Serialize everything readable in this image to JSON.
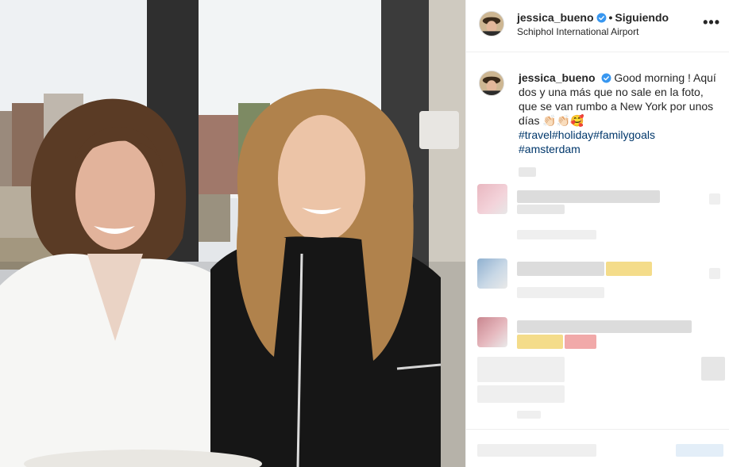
{
  "post": {
    "username": "jessica_bueno",
    "follow_status": "Siguiendo",
    "location": "Schiphol International Airport",
    "more_label": "•••"
  },
  "caption": {
    "username": "jessica_bueno",
    "text": "Good morning ! Aquí dos y una más que no sale en la foto, que se van rumbo a New York por unos días 👏🏻👏🏻🥰",
    "hashtags_line1": "#travel#holiday#familygoals",
    "hashtags_line2": "#amsterdam"
  },
  "colors": {
    "verified_badge": "#3897f0",
    "hashtag": "#00376b",
    "text": "#262626",
    "divider": "#efefef"
  },
  "icons": {
    "verified": "verified-badge-icon",
    "more": "more-options-icon"
  }
}
